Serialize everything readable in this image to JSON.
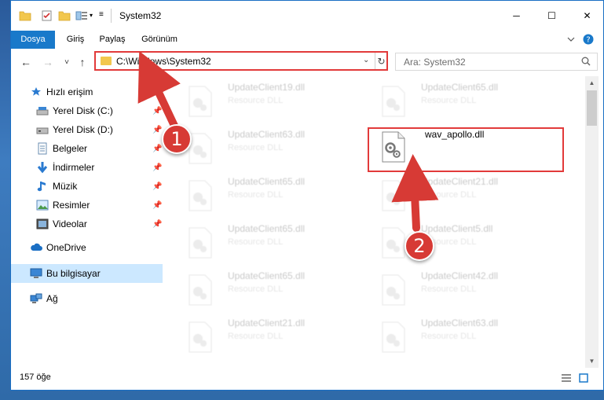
{
  "window": {
    "title": "System32",
    "controls": {
      "minimize": "─",
      "maximize": "☐",
      "close": "✕"
    }
  },
  "ribbon": {
    "tabs": [
      {
        "label": "Dosya",
        "active": true
      },
      {
        "label": "Giriş"
      },
      {
        "label": "Paylaş"
      },
      {
        "label": "Görünüm"
      }
    ],
    "expand_icon": "chevron-down-icon",
    "help_icon": "help-icon"
  },
  "nav": {
    "back": "←",
    "forward": "→",
    "recent": "˅",
    "up": "↑",
    "address": "C:\\Windows\\System32",
    "address_dropdown": "⌄",
    "refresh": "↻",
    "search_placeholder": "Ara: System32"
  },
  "sidebar": {
    "items": [
      {
        "label": "Hızlı erişim",
        "icon": "star-icon",
        "pinned": false
      },
      {
        "label": "Yerel Disk (C:)",
        "icon": "drive-icon",
        "pinned": true
      },
      {
        "label": "Yerel Disk (D:)",
        "icon": "drive-icon",
        "pinned": true
      },
      {
        "label": "Belgeler",
        "icon": "documents-icon",
        "pinned": true
      },
      {
        "label": "İndirmeler",
        "icon": "download-icon",
        "pinned": true
      },
      {
        "label": "Müzik",
        "icon": "music-icon",
        "pinned": true
      },
      {
        "label": "Resimler",
        "icon": "pictures-icon",
        "pinned": true
      },
      {
        "label": "Videolar",
        "icon": "videos-icon",
        "pinned": true
      },
      {
        "label": "OneDrive",
        "icon": "cloud-icon",
        "pinned": false
      },
      {
        "label": "Bu bilgisayar",
        "icon": "computer-icon",
        "pinned": false,
        "selected": true
      },
      {
        "label": "Ağ",
        "icon": "network-icon",
        "pinned": false
      }
    ]
  },
  "files": {
    "left_column": [
      {
        "name": "UpdateClient19.dll",
        "type": "Resource DLL"
      },
      {
        "name": "UpdateClient63.dll",
        "type": "Resource DLL"
      },
      {
        "name": "UpdateClient65.dll",
        "type": "Resource DLL"
      },
      {
        "name": "UpdateClient65.dll",
        "type": "Resource DLL"
      },
      {
        "name": "UpdateClient65.dll",
        "type": "Resource DLL"
      },
      {
        "name": "UpdateClient21.dll",
        "type": "Resource DLL"
      }
    ],
    "right_column": [
      {
        "name": "UpdateClient65.dll",
        "type": "Resource DLL"
      },
      {
        "name": "wav_apollo.dll",
        "type": "",
        "highlighted": true
      },
      {
        "name": "UpdateClient21.dll",
        "type": "Resource DLL"
      },
      {
        "name": "UpdateClient5.dll",
        "type": "Resource DLL"
      },
      {
        "name": "UpdateClient42.dll",
        "type": "Resource DLL"
      },
      {
        "name": "UpdateClient63.dll",
        "type": "Resource DLL"
      }
    ]
  },
  "status": {
    "item_count": "157 öğe"
  },
  "annotations": {
    "step1": "1",
    "step2": "2",
    "color": "#d73a35"
  },
  "colors": {
    "accent": "#1979ca",
    "selection": "#cce8ff",
    "highlight_border": "#e23a3a"
  }
}
